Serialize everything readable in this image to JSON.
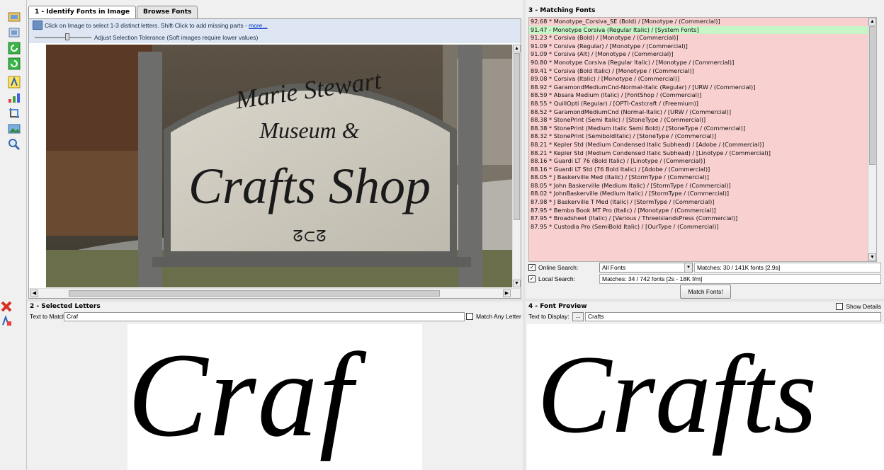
{
  "panel1": {
    "tabs": [
      "1 - Identify Fonts in Image",
      "Browse Fonts"
    ],
    "hint_text": "Click on Image to select 1-3 distinct letters. Shift-Click to add missing parts - ",
    "hint_link": "more...",
    "tolerance_label": "Adjust Selection Tolerance (Soft images require lower values)",
    "tolerance_level_fraction": 0.58,
    "sign": {
      "line1": "Marie Stewart",
      "line2": "Museum &",
      "line3": "Crafts Shop",
      "ornament": "ᘔ⊂ᘔ"
    }
  },
  "panel3": {
    "title": "3 - Matching Fonts",
    "selected_index": 1,
    "matches": [
      "92.68 * Monotype_Corsiva_SE (Bold) / [Monotype / (Commercial)]",
      "91.47 - Monotype Corsiva (Regular Italic) / [System Fonts]",
      "91.23 * Corsiva (Bold) / [Monotype / (Commercial)]",
      "91.09 * Corsiva (Regular) / [Monotype / (Commercial)]",
      "91.09 * Corsiva (Alt) / [Monotype / (Commercial)]",
      "90.80 * Monotype Corsiva (Regular Italic) / [Monotype / (Commercial)]",
      "89.41 * Corsiva (Bold Italic) / [Monotype / (Commercial)]",
      "89.08 * Corsiva (Italic) / [Monotype / (Commercial)]",
      "88.92 * GaramondMediumCnd-Normal-Italic (Regular) / [URW / (Commercial)]",
      "88.59 * Absara Medium (Italic) / [FontShop / (Commercial)]",
      "88.55 * QuillOpti (Regular) / [OPTI-Castcraft / (Freemium)]",
      "88.52 * GaramondMediumCnd (Normal-Italic) / [URW / (Commercial)]",
      "88.38 * StonePrint (Semi Italic) / [StoneType / (Commercial)]",
      "88.38 * StonePrint (Medium Italic Semi Bold) / [StoneType / (Commercial)]",
      "88.32 * StonePrint (SemiboldItalic) / [StoneType / (Commercial)]",
      "88.21 * Kepler Std (Medium Condensed Italic Subhead) / [Adobe / (Commercial)]",
      "88.21 * Kepler Std (Medium Condensed Italic Subhead) / [Linotype / (Commercial)]",
      "88.16 * Guardi LT 76 (Bold Italic) / [Linotype / (Commercial)]",
      "88.16 * Guardi LT Std (76 Bold Italic) / [Adobe / (Commercial)]",
      "88.05 * J Baskerville Med (Italic) / [StormType / (Commercial)]",
      "88.05 * John Baskerville (Medium Italic) / [StormType / (Commercial)]",
      "88.02 * JohnBaskerville (Medium Italic) / [StormType / (Commercial)]",
      "87.98 * J Baskerville T Med (Italic) / [StormType / (Commercial)]",
      "87.95 * Bembo Book MT Pro (Italic) / [Monotype / (Commercial)]",
      "87.95 * Broadsheet (Italic) / [Various / ThreeIslandsPress (Commercial)]",
      "87.95 * Custodia Pro (SemiBold Italic) / [OurType / (Commercial)]"
    ],
    "online_search_label": "Online Search:",
    "online_search_value": "All Fonts",
    "online_status": "Matches: 30 / 141K fonts [2.9s]",
    "local_search_label": "Local Search:",
    "local_status": "Matches: 34 / 742 fonts [2s - 18K f/m]",
    "match_button": "Match Fonts!"
  },
  "panel2": {
    "title": "2 - Selected Letters",
    "text_label": "Text to Match:",
    "text_value": "Craf",
    "match_any_label": "Match Any Letter"
  },
  "panel4": {
    "title": "4 - Font Preview",
    "show_details_label": "Show Details",
    "text_label": "Text to Display:",
    "dots_button": "...",
    "text_value": "Crafts"
  },
  "colors": {
    "match_list_bg": "#f8d0d0",
    "selected_row_bg": "#c6f5c6",
    "hint_bar_bg": "#dde6f2"
  }
}
